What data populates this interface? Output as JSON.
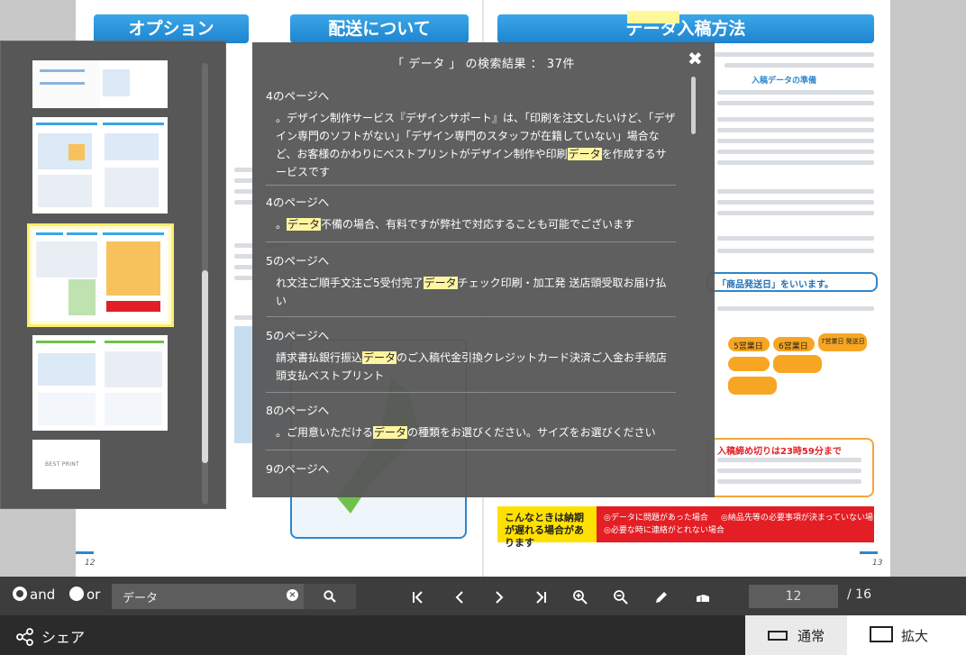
{
  "document": {
    "sections": [
      "オプション",
      "配送について",
      "データ入稿方法"
    ],
    "left_page_number": "12",
    "right_page_number": "13",
    "notes": [
      "入稿データの準備",
      "「商品発送日」をいいます。",
      "入稿締め切りは23時59分まで"
    ],
    "steps": [
      "5営業日",
      "6営業日",
      "7営業日 発送日"
    ],
    "warning_title": "こんなときは納期が遅れる場合があります",
    "warning_options": [
      "◎データに問題があった場合",
      "◎納品先等の必要事項が決まっていない場合",
      "◎必要な時に連絡がとれない場合"
    ]
  },
  "thumbnails": {
    "list_icon": "list-icon",
    "logo_text": "BEST PRINT"
  },
  "search_results": {
    "title": "「 データ 」 の検索結果 ： 37件",
    "close_icon": "✖",
    "items": [
      {
        "page": "4のページへ",
        "before": "。デザイン制作サービス『デザインサポート』は、「印刷を注文したいけど、「デザイン専門のソフトがない」「デザイン専門のスタッフが在籍していない」場合など、お客様のかわりにベストプリントがデザイン制作や印刷",
        "hit": "データ",
        "after": "を作成するサービスです"
      },
      {
        "page": "4のページへ",
        "before": "。",
        "hit": "データ",
        "after": "不備の場合、有料ですが弊社で対応することも可能でございます"
      },
      {
        "page": "5のページへ",
        "before": "れ文注ご順手文注ご5受付完了",
        "hit": "データ",
        "after": "チェック印刷・加工発 送店頭受取お届け払い"
      },
      {
        "page": "5のページへ",
        "before": "請求書払銀行振込",
        "hit": "データ",
        "after": "のご入稿代金引換クレジットカード決済ご入金お手続店頭支払ベストプリント"
      },
      {
        "page": "8のページへ",
        "before": "。ご用意いただける",
        "hit": "データ",
        "after": "の種類をお選びください。サイズをお選びください"
      },
      {
        "page": "9のページへ",
        "before": "",
        "hit": "",
        "after": ""
      }
    ]
  },
  "toolbar": {
    "and_label": "and",
    "or_label": "or",
    "search_value": "データ",
    "clear_icon": "×",
    "current_page": "12",
    "total_pages": "/ 16"
  },
  "footer": {
    "share_label": "シェア",
    "normal_label": "通常",
    "zoom_label": "拡大"
  }
}
